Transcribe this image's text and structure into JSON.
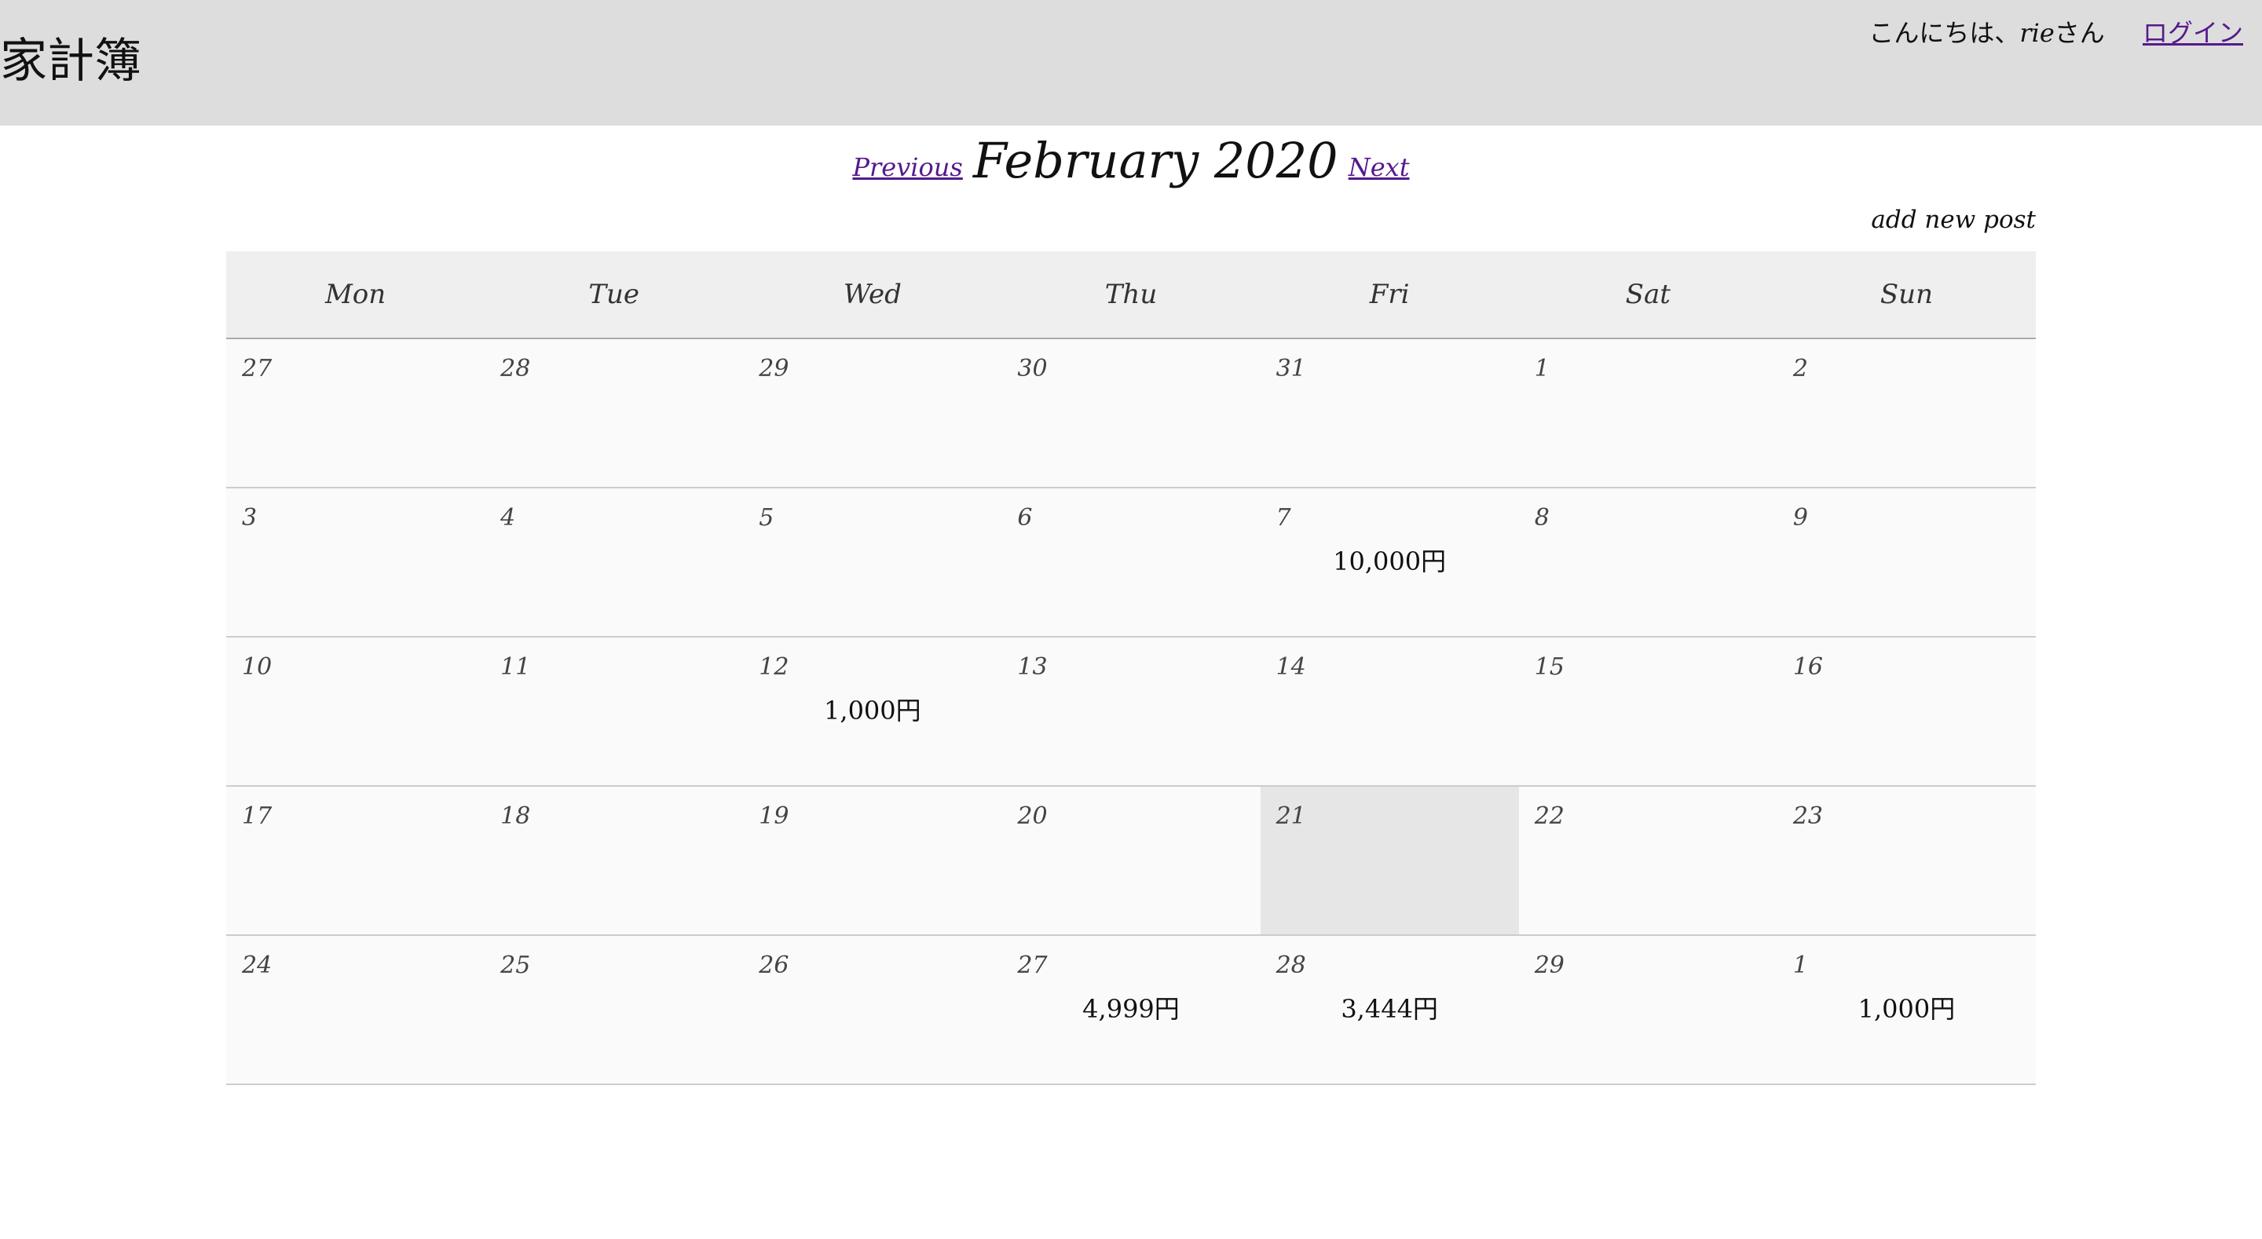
{
  "header": {
    "site_title": "家計簿",
    "greeting_prefix": "こんにちは、",
    "username": "rie",
    "greeting_suffix": "さん",
    "login_label": "ログイン"
  },
  "nav": {
    "previous_label": "Previous",
    "month_title": "February 2020",
    "next_label": "Next"
  },
  "add_post_label": "add new post",
  "calendar": {
    "weekdays": [
      "Mon",
      "Tue",
      "Wed",
      "Thu",
      "Fri",
      "Sat",
      "Sun"
    ],
    "weeks": [
      [
        {
          "day": "27",
          "amount": ""
        },
        {
          "day": "28",
          "amount": ""
        },
        {
          "day": "29",
          "amount": ""
        },
        {
          "day": "30",
          "amount": ""
        },
        {
          "day": "31",
          "amount": ""
        },
        {
          "day": "1",
          "amount": ""
        },
        {
          "day": "2",
          "amount": ""
        }
      ],
      [
        {
          "day": "3",
          "amount": ""
        },
        {
          "day": "4",
          "amount": ""
        },
        {
          "day": "5",
          "amount": ""
        },
        {
          "day": "6",
          "amount": ""
        },
        {
          "day": "7",
          "amount": "10,000円"
        },
        {
          "day": "8",
          "amount": ""
        },
        {
          "day": "9",
          "amount": ""
        }
      ],
      [
        {
          "day": "10",
          "amount": ""
        },
        {
          "day": "11",
          "amount": ""
        },
        {
          "day": "12",
          "amount": "1,000円"
        },
        {
          "day": "13",
          "amount": ""
        },
        {
          "day": "14",
          "amount": ""
        },
        {
          "day": "15",
          "amount": ""
        },
        {
          "day": "16",
          "amount": ""
        }
      ],
      [
        {
          "day": "17",
          "amount": ""
        },
        {
          "day": "18",
          "amount": ""
        },
        {
          "day": "19",
          "amount": ""
        },
        {
          "day": "20",
          "amount": ""
        },
        {
          "day": "21",
          "amount": "",
          "today": true
        },
        {
          "day": "22",
          "amount": ""
        },
        {
          "day": "23",
          "amount": ""
        }
      ],
      [
        {
          "day": "24",
          "amount": ""
        },
        {
          "day": "25",
          "amount": ""
        },
        {
          "day": "26",
          "amount": ""
        },
        {
          "day": "27",
          "amount": "4,999円"
        },
        {
          "day": "28",
          "amount": "3,444円"
        },
        {
          "day": "29",
          "amount": ""
        },
        {
          "day": "1",
          "amount": "1,000円"
        }
      ]
    ]
  }
}
